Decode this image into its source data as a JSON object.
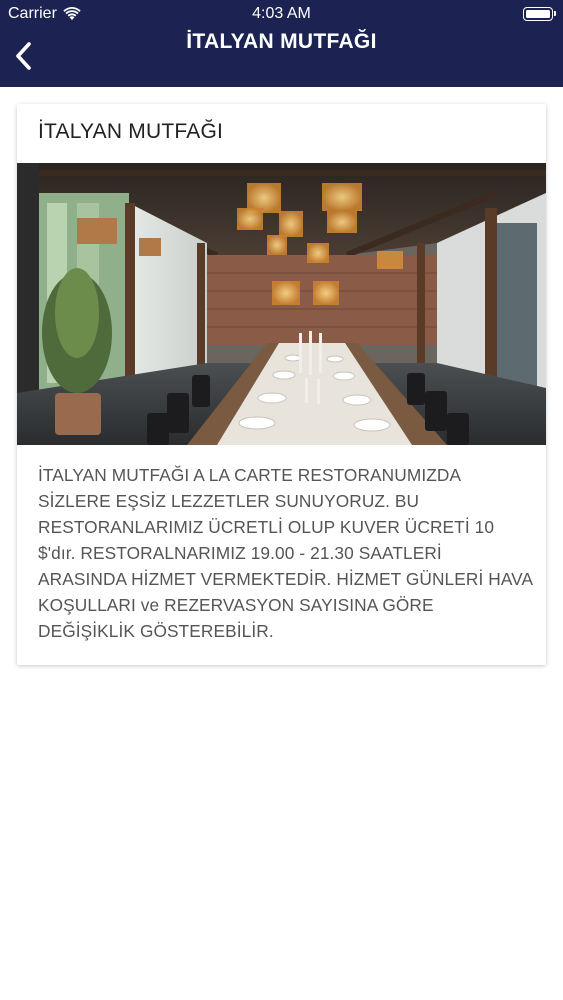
{
  "status_bar": {
    "carrier": "Carrier",
    "time": "4:03 AM"
  },
  "nav": {
    "title": "İTALYAN MUTFAĞI",
    "back_icon": "chevron-left-icon"
  },
  "card": {
    "title": "İTALYAN MUTFAĞI",
    "image_description_icon": "restaurant-photo",
    "body": "İTALYAN MUTFAĞI A LA CARTE RESTORANUMIZDA SİZLERE EŞSİZ LEZZETLER SUNUYORUZ. BU RESTORANLARIMIZ ÜCRETLİ OLUP KUVER ÜCRETİ 10 $'dır. RESTORALNARIMIZ 19.00 - 21.30 SAATLERİ ARASINDA HİZMET VERMEKTEDİR. HİZMET GÜNLERİ HAVA KOŞULLARI ve REZERVASYON SAYISINA GÖRE DEĞİŞİKLİK GÖSTEREBİLİR."
  },
  "colors": {
    "nav_background": "#1c2352",
    "text": "#555555"
  }
}
